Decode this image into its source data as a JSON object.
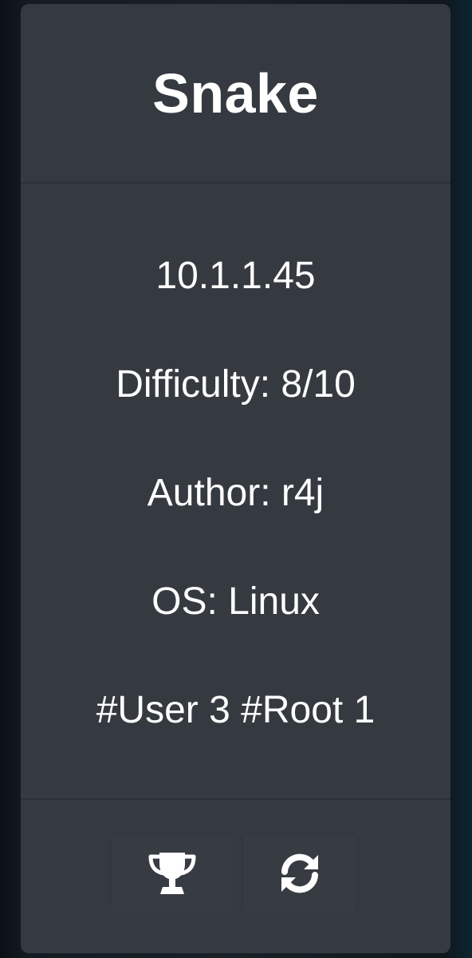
{
  "machine": {
    "name": "Snake",
    "ip": "10.1.1.45",
    "difficulty": "Difficulty: 8/10",
    "author": "Author: r4j",
    "os": "OS: Linux",
    "stats": "#User 3 #Root 1"
  },
  "actions": [
    {
      "icon": "trophy-icon"
    },
    {
      "icon": "refresh-icon"
    }
  ]
}
